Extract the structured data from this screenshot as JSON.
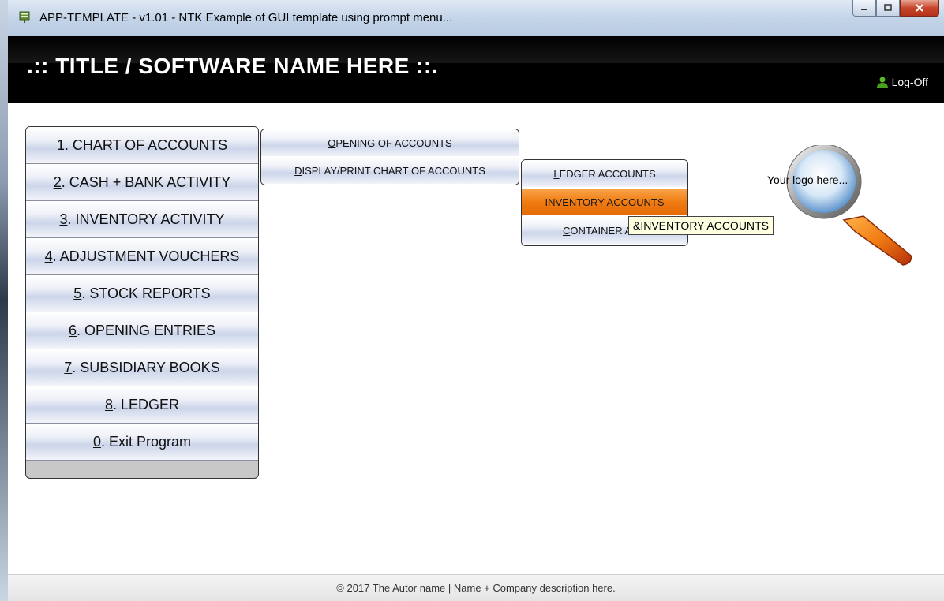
{
  "window": {
    "title": "APP-TEMPLATE - v1.01 -  NTK Example of GUI template using prompt menu...",
    "buttons": [
      "minimize",
      "maximize",
      "close"
    ]
  },
  "header": {
    "title": ".:: TITLE / SOFTWARE NAME HERE ::.",
    "logoff_label": "Log-Off",
    "logoff_icon": "user-icon"
  },
  "main_menu": {
    "items": [
      {
        "key": "1",
        "label": ". CHART OF ACCOUNTS"
      },
      {
        "key": "2",
        "label": ". CASH + BANK ACTIVITY"
      },
      {
        "key": "3",
        "label": ". INVENTORY ACTIVITY"
      },
      {
        "key": "4",
        "label": ". ADJUSTMENT VOUCHERS"
      },
      {
        "key": "5",
        "label": ". STOCK REPORTS"
      },
      {
        "key": "6",
        "label": ". OPENING ENTRIES"
      },
      {
        "key": "7",
        "label": ". SUBSIDIARY BOOKS"
      },
      {
        "key": "8",
        "label": ". LEDGER"
      },
      {
        "key": "0",
        "label": ". Exit Program"
      }
    ]
  },
  "submenu_chart": {
    "items": [
      {
        "key": "O",
        "label": "PENING OF ACCOUNTS"
      },
      {
        "key": "D",
        "label": "ISPLAY/PRINT CHART OF ACCOUNTS"
      }
    ]
  },
  "submenu_display": {
    "items": [
      {
        "key": "L",
        "label": "EDGER ACCOUNTS"
      },
      {
        "key": "I",
        "label": "NVENTORY ACCOUNTS"
      },
      {
        "key": "C",
        "label": "ONTAINER ACC"
      }
    ],
    "active_index": 1
  },
  "tooltip": "&INVENTORY ACCOUNTS",
  "logo": {
    "text": "Your logo here...",
    "icon": "magnifier-icon"
  },
  "footer": {
    "text": "© 2017  The Autor name   |   Name + Company description here."
  },
  "colors": {
    "header_bg": "#000000",
    "active_item": "#f07c12",
    "tooltip_bg": "#ffffe1"
  }
}
